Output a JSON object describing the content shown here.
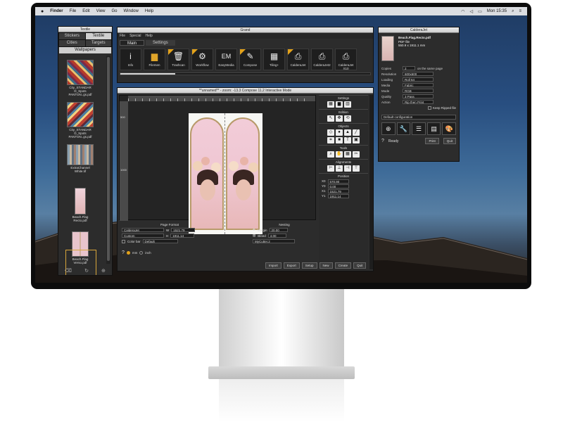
{
  "menubar": {
    "apple": "",
    "app": "Finder",
    "items": [
      "File",
      "Edit",
      "View",
      "Go",
      "Window",
      "Help"
    ],
    "clock": "Mon 15:35"
  },
  "textile": {
    "title": "Textile",
    "tabs": [
      "Stickers",
      "Textile",
      "Cities",
      "Targets"
    ],
    "wide_tab": "Wallpapers",
    "thumbs": [
      {
        "caption": "City_STANDAR D_Spots PANTON..gs.pdf"
      },
      {
        "caption": "City_STANDAR D_Spots PANTON..gs.pdf"
      },
      {
        "caption": "ExtraChannel White.tif"
      },
      {
        "caption": "Beach.Flag Recto.pdf"
      },
      {
        "caption": "Beach.Flag Verso.pdf"
      }
    ]
  },
  "grand": {
    "title": "Grand",
    "menu": [
      "File",
      "Special",
      "Help"
    ],
    "tabs": [
      "Main",
      "Settings"
    ],
    "tools": [
      {
        "label": "Info",
        "icon": "i",
        "tri": false
      },
      {
        "label": "Filemen",
        "icon": "▆",
        "tri": false
      },
      {
        "label": "Trashcan",
        "icon": "🗑",
        "tri": true
      },
      {
        "label": "Workflow",
        "icon": "⚙",
        "tri": true
      },
      {
        "label": "EasyMedia",
        "icon": "EM",
        "tri": false
      },
      {
        "label": "Compose",
        "icon": "✎",
        "tri": true
      },
      {
        "label": "Tiling+",
        "icon": "▦",
        "tri": false
      },
      {
        "label": "CalderaJet",
        "icon": "⎙",
        "tri": true
      },
      {
        "label": "CalderaJet2",
        "icon": "⎙",
        "tri": false
      },
      {
        "label": "CalderaJet X10",
        "icon": "⎙",
        "tri": false
      }
    ],
    "progress": 0.22
  },
  "calderajet": {
    "title": "CalderaJet",
    "file": "Beach.Flag.Recto.pdf",
    "type": "PDF file",
    "size": "550.9 x 1911.1 mm",
    "rows": [
      {
        "k": "Copies",
        "v": "2",
        "x": "on the same page"
      },
      {
        "k": "Resolution",
        "v": "600x600",
        "x": ""
      },
      {
        "k": "Loading",
        "v": "Roll 64",
        "x": ""
      },
      {
        "k": "Media",
        "v": "Fabric",
        "x": ""
      },
      {
        "k": "Mode",
        "v": "RGB",
        "x": ""
      },
      {
        "k": "Quality",
        "v": "3 Pass",
        "x": ""
      },
      {
        "k": "Action",
        "v": "Rip then Print",
        "x": ""
      }
    ],
    "keep_ripped": "Keep Ripped file",
    "config": "Default configuration",
    "status": "Ready",
    "print_btn": "Print",
    "quit_btn": "Quit"
  },
  "compose": {
    "title": "**unnamed** - zoom: -13.3 Compose 11.2 Interactive Mode",
    "sections": [
      "Settings",
      "Edition",
      "Objects",
      "Tools",
      "Alignments",
      "Position"
    ],
    "position": [
      {
        "k": "X0",
        "v": "570.90"
      },
      {
        "k": "Y0",
        "v": "0.00"
      },
      {
        "k": "X1",
        "v": "1521.79"
      },
      {
        "k": "Y1",
        "v": "1911.14"
      }
    ],
    "page_format": {
      "label": "Page Format",
      "printer": "CalderaJet",
      "mode": "Custom",
      "w_label": "W",
      "w": "1521.79",
      "h_label": "H",
      "h": "1911.14",
      "color_bar": "Color bar",
      "default": "Default"
    },
    "nesting": {
      "label": "Nesting",
      "margin_label": "Margin",
      "margin": "20.00",
      "bleed_label": "Bleed",
      "bleed": "4.00",
      "cutter": "MyCutter.2"
    },
    "units": [
      "mm",
      "inch"
    ],
    "buttons": [
      "Import",
      "Export",
      "Setup",
      "New",
      "Create",
      "Quit"
    ],
    "ruler_labels": [
      "500",
      "1000"
    ]
  }
}
